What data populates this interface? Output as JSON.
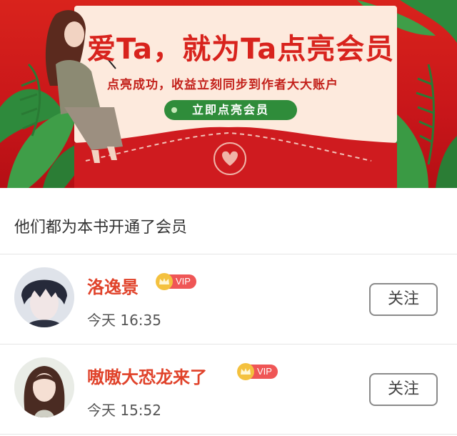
{
  "banner": {
    "title": "爱Ta，就为Ta点亮会员",
    "subtitle": "点亮成功，收益立刻同步到作者大大账户",
    "button_label": "立即点亮会员"
  },
  "section": {
    "title": "他们都为本书开通了会员"
  },
  "members": [
    {
      "name": "洛逸景",
      "vip_label": "VIP",
      "time": "今天 16:35",
      "follow_label": "关注"
    },
    {
      "name": "嗷嗷大恐龙来了",
      "vip_label": "VIP",
      "time": "今天 15:52",
      "follow_label": "关注"
    }
  ],
  "colors": {
    "banner_red": "#c8161a",
    "card": "#fdeadd",
    "accent_green": "#2f8c3a",
    "name_red": "#e0422a",
    "vip_red": "#ef5656",
    "crown_gold": "#f4c13e"
  }
}
